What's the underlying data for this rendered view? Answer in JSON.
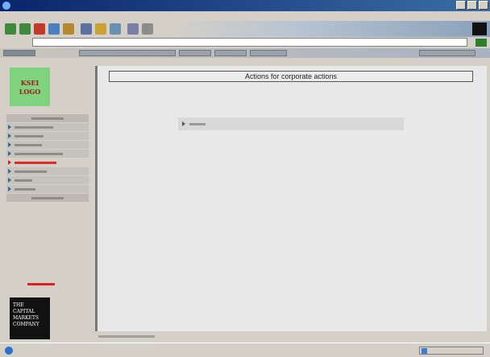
{
  "content": {
    "heading": "Actions for corporate actions"
  },
  "sidebar": {
    "logo_top": "KSEI\nLOGO",
    "logo_bottom": "THE\nCAPITAL\nMARKETS\nCOMPANY",
    "nav_rows": 13
  },
  "colors": {
    "logo_green": "#7fd37f",
    "logo_text_red": "#a01b1b",
    "accent_red": "#e02020",
    "title_blue": "#0a246a"
  },
  "icons": [
    "internet-explorer-icon",
    "back-icon",
    "forward-icon",
    "stop-icon",
    "refresh-icon",
    "home-icon",
    "search-icon",
    "favorites-icon",
    "history-icon",
    "mail-icon",
    "print-icon",
    "ie-throbber-icon",
    "go-arrow-icon",
    "internet-zone-icon"
  ]
}
